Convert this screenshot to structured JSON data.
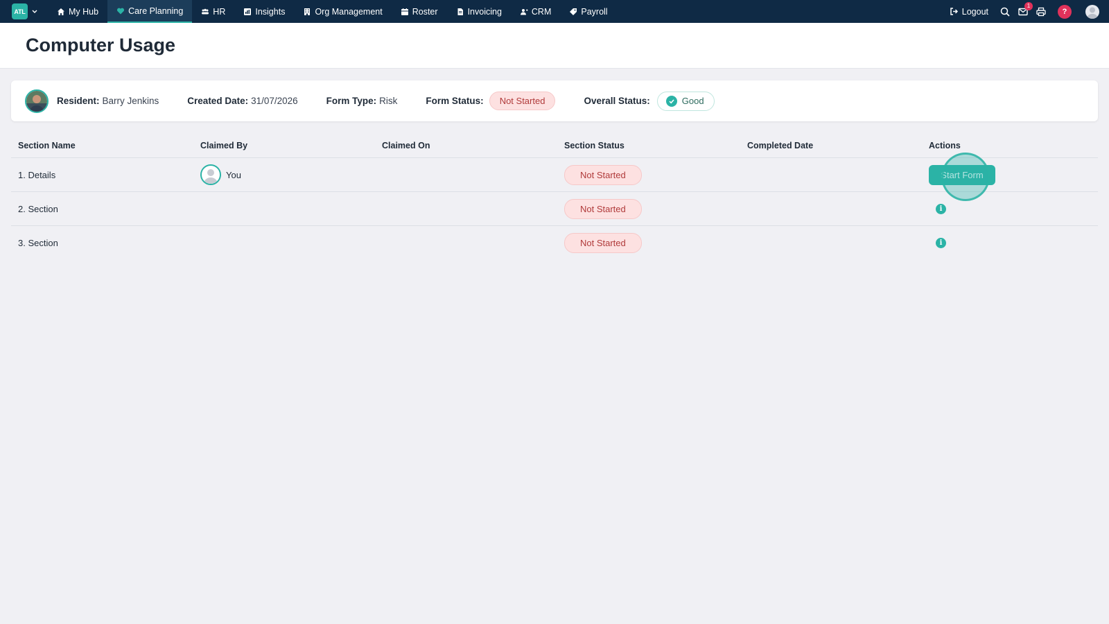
{
  "nav": {
    "brand": "ATL",
    "items": [
      {
        "label": "My Hub",
        "icon": "home-icon"
      },
      {
        "label": "Care Planning",
        "icon": "heart-icon",
        "active": true
      },
      {
        "label": "HR",
        "icon": "people-icon"
      },
      {
        "label": "Insights",
        "icon": "chart-icon"
      },
      {
        "label": "Org Management",
        "icon": "building-icon"
      },
      {
        "label": "Roster",
        "icon": "calendar-icon"
      },
      {
        "label": "Invoicing",
        "icon": "document-icon"
      },
      {
        "label": "CRM",
        "icon": "users-icon"
      },
      {
        "label": "Payroll",
        "icon": "tag-icon"
      }
    ],
    "logout_label": "Logout",
    "mail_count": "1",
    "help_label": "?"
  },
  "page": {
    "title": "Computer Usage"
  },
  "info": {
    "resident_label": "Resident:",
    "resident_value": "Barry Jenkins",
    "created_label": "Created Date:",
    "created_value": "31/07/2026",
    "form_type_label": "Form Type:",
    "form_type_value": "Risk",
    "form_status_label": "Form Status:",
    "form_status_value": "Not Started",
    "overall_label": "Overall Status:",
    "overall_value": "Good"
  },
  "table": {
    "headers": [
      "Section Name",
      "Claimed By",
      "Claimed On",
      "Section Status",
      "Completed Date",
      "Actions"
    ],
    "rows": [
      {
        "name": "1. Details",
        "claimed_by": "You",
        "claimed_on": "",
        "status": "Not Started",
        "completed": "",
        "action": "Start Form"
      },
      {
        "name": "2. Section",
        "claimed_by": "",
        "claimed_on": "",
        "status": "Not Started",
        "completed": "",
        "action": "info"
      },
      {
        "name": "3. Section",
        "claimed_by": "",
        "claimed_on": "",
        "status": "Not Started",
        "completed": "",
        "action": "info"
      }
    ]
  },
  "colors": {
    "nav_bg": "#0f2a45",
    "accent": "#2bb3a6",
    "status_red_bg": "#fde1e1",
    "status_red_text": "#b03a3a",
    "alert": "#e0325b"
  }
}
